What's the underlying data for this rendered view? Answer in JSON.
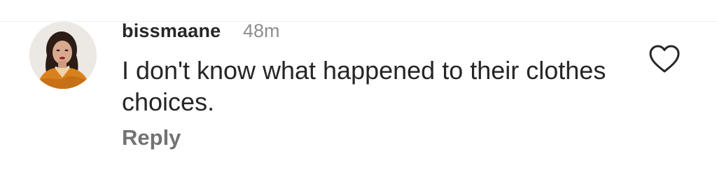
{
  "comment": {
    "username": "bissmaane",
    "timestamp": "48m",
    "text": "I don't know what happened to their clothes choices.",
    "reply_label": "Reply"
  },
  "icons": {
    "like": "heart-outline-icon",
    "avatar": "user-avatar"
  },
  "colors": {
    "username": "#262626",
    "timestamp": "#8e8e8e",
    "reply": "#737373",
    "heart_stroke": "#262626"
  }
}
